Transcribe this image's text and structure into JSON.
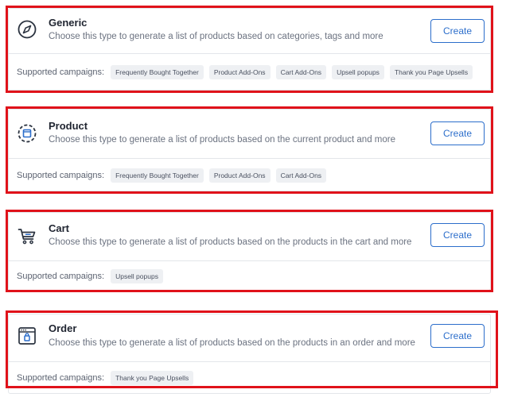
{
  "supported_label": "Supported campaigns:",
  "create_label": "Create",
  "colors": {
    "accent": "#2c6ecb",
    "highlight_frame": "#e0121a",
    "chip_bg": "#eef0f3"
  },
  "types": [
    {
      "icon": "compass-icon",
      "title": "Generic",
      "description": "Choose this type to generate a list of products based on categories, tags and more",
      "campaigns": [
        "Frequently Bought Together",
        "Product Add-Ons",
        "Cart Add-Ons",
        "Upsell popups",
        "Thank you Page Upsells"
      ]
    },
    {
      "icon": "product-box-icon",
      "title": "Product",
      "description": "Choose this type to generate a list of products based on the current product and more",
      "campaigns": [
        "Frequently Bought Together",
        "Product Add-Ons",
        "Cart Add-Ons"
      ]
    },
    {
      "icon": "cart-icon",
      "title": "Cart",
      "description": "Choose this type to generate a list of products based on the products in the cart and more",
      "campaigns": [
        "Upsell popups"
      ]
    },
    {
      "icon": "order-window-icon",
      "title": "Order",
      "description": "Choose this type to generate a list of products based on the products in an order and more",
      "campaigns": [
        "Thank you Page Upsells"
      ]
    }
  ]
}
